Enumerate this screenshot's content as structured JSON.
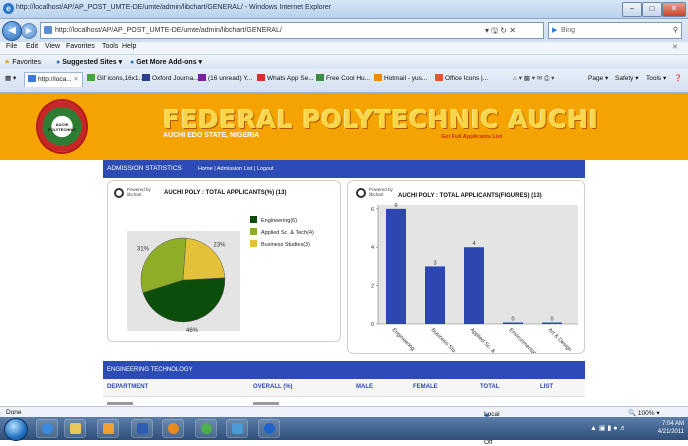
{
  "window": {
    "title": "http://localhost/AP/AP_POST_UMTE-DE/umte/admin/libchart/GENERAL/ - Windows Internet Explorer",
    "minimize": "–",
    "maximize": "□",
    "close": "✕"
  },
  "address": {
    "url": "http://localhost/AP/AP_POST_UMTE-DE/umte/admin/libchart/GENERAL/",
    "search_placeholder": "Bing",
    "controls": "▾  🖫  ↻  ✕"
  },
  "menu": [
    "File",
    "Edit",
    "View",
    "Favorites",
    "Tools",
    "Help"
  ],
  "favorites": {
    "label": "Favorites",
    "items": [
      "Suggested Sites ▾",
      "Get More Add-ons ▾"
    ]
  },
  "tabs": [
    {
      "label": "http://loca..."
    },
    {
      "label": "GIf icons,16x1..."
    },
    {
      "label": "Oxford Journa..."
    },
    {
      "label": "(16 unread) Y..."
    },
    {
      "label": "Whats App Se..."
    },
    {
      "label": "Free Cool Hu..."
    },
    {
      "label": "Hotmail - yus..."
    },
    {
      "label": "Office Icons |..."
    }
  ],
  "toolbar": {
    "page": "Page ▾",
    "safety": "Safety ▾",
    "tools": "Tools ▾"
  },
  "banner": {
    "title": "FEDERAL POLYTECHNIC AUCHI",
    "subtitle": "AUCHI EDO STATE, NIGERIA",
    "link": "Get Full Applicants List",
    "logo_text": "AUCHI POLYTECHNIC"
  },
  "admission": {
    "header": "ADMISSION STATISTICS",
    "links": "Home | Admission List | Logout"
  },
  "powered_by": "Powered by\nlibchart",
  "chart_data": [
    {
      "type": "pie",
      "title": "AUCHI POLY : TOTAL APPLICANTS(%) (13)",
      "categories": [
        "Engineering(6)",
        "Applied Sc. & Tech(4)",
        "Business Studies(3)"
      ],
      "values": [
        46,
        31,
        23
      ],
      "labels": [
        "46%",
        "31%",
        "23%"
      ],
      "colors": [
        "#0b4d0b",
        "#8fae28",
        "#e3c23a"
      ],
      "legend": "right"
    },
    {
      "type": "bar",
      "title": "AUCHI POLY : TOTAL APPLICANTS(FIGURES) (13)",
      "categories": [
        "Engineering",
        "Business Stu...",
        "Applied Sc. &...",
        "Environmental...",
        "Art & Design"
      ],
      "values": [
        6,
        3,
        4,
        0,
        0
      ],
      "yticks": [
        0,
        2,
        4,
        6
      ],
      "ylim": [
        0,
        6.2
      ],
      "color": "#2c47b0"
    }
  ],
  "engineering": {
    "header": "ENGINEERING TECHNOLOGY",
    "columns": [
      "DEPARTMENT",
      "OVERALL (%)",
      "MALE",
      "FEMALE",
      "TOTAL",
      "LIST"
    ]
  },
  "status": {
    "left": "Done",
    "zone": "Local intranet | Protected Mode: Off",
    "zoom": "🔍 100% ▾"
  },
  "taskbar": {
    "time": "7:04 AM",
    "date": "4/21/2011"
  }
}
